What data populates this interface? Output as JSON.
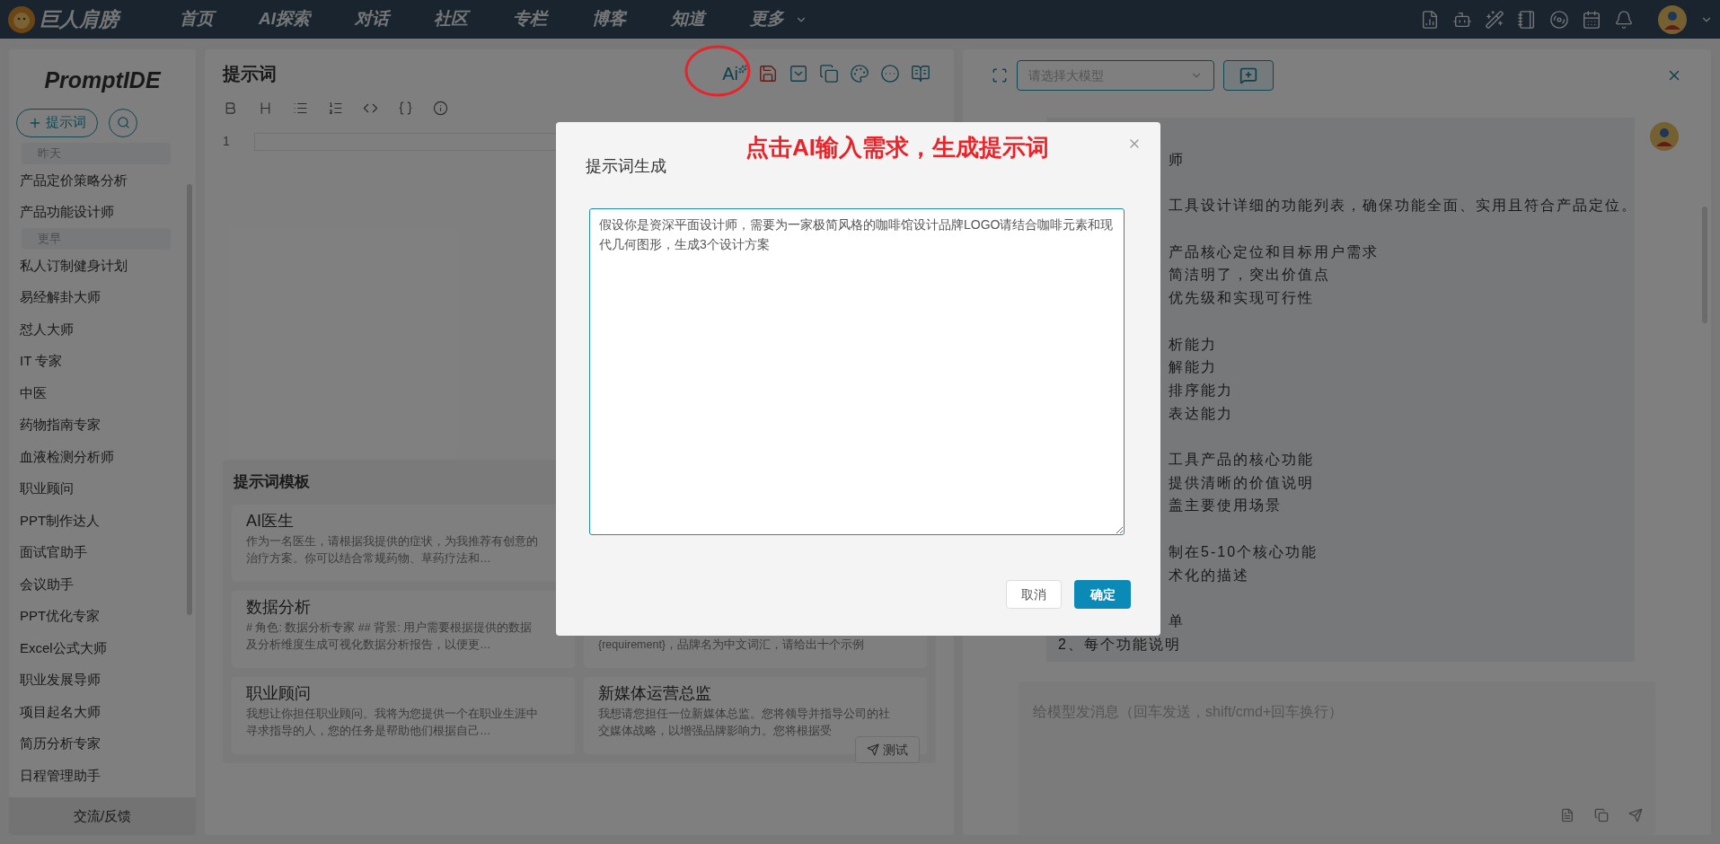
{
  "nav": {
    "logo": "巨人肩膀",
    "links": [
      "首页",
      "AI探索",
      "对话",
      "社区",
      "专栏",
      "博客",
      "知道"
    ],
    "more": "更多"
  },
  "sidebar": {
    "title": "PromptIDE",
    "new_button": "提示词",
    "groups": [
      {
        "label": "昨天",
        "items": [
          "产品定价策略分析",
          "产品功能设计师"
        ]
      },
      {
        "label": "更早",
        "items": [
          "私人订制健身计划",
          "易经解卦大师",
          "怼人大师",
          "IT 专家",
          "中医",
          "药物指南专家",
          "血液检测分析师",
          "职业顾问",
          "PPT制作达人",
          "面试官助手",
          "会议助手",
          "PPT优化专家",
          "Excel公式大师",
          "职业发展导师",
          "项目起名大师",
          "简历分析专家",
          "日程管理助手"
        ]
      }
    ],
    "feedback": "交流/反馈"
  },
  "editor": {
    "title": "提示词",
    "ai_button": "Ai",
    "line_numbers": [
      "1"
    ],
    "templates": {
      "title": "提示词模板",
      "rows": [
        {
          "left": {
            "title": "AI医生",
            "text": "作为一名医生，请根据我提供的症状，为我推荐有创意的治疗方案。你可以结合常规药物、草药疗法和…"
          }
        },
        {
          "left": {
            "title": "数据分析",
            "text": "# 角色: 数据分析专家 ## 背景: 用户需要根据提供的数据及分析维度生成可视化数据分析报告，以便更…"
          },
          "right": {
            "text": "{requirement}，品牌名为中文词汇，请给出十个示例"
          }
        },
        {
          "left": {
            "title": "职业顾问",
            "text": "我想让你担任职业顾问。我将为您提供一个在职业生涯中寻求指导的人，您的任务是帮助他们根据自己…"
          },
          "right": {
            "title": "新媒体运营总监",
            "text": "我想请您担任一位新媒体总监。您将领导并指导公司的社交媒体战略，以增强品牌影响力。您将根据受"
          }
        }
      ]
    },
    "test_button": "测试"
  },
  "chat": {
    "model_select": {
      "placeholder": "请选择大模型"
    },
    "paragraphs": [
      [
        {
          "text": "师",
          "kind": "clipped"
        }
      ],
      [
        {
          "text": "工具设计详细的功能列表，确保功能全面、实用且符合产品定位。",
          "kind": "clipped"
        }
      ],
      [
        {
          "text": "产品核心定位和目标用户需求",
          "kind": "clipped"
        },
        {
          "text": "简洁明了，突出价值点",
          "kind": "clipped"
        },
        {
          "text": "优先级和实现可行性",
          "kind": "clipped"
        }
      ],
      [
        {
          "text": "析能力",
          "kind": "clipped"
        },
        {
          "text": "解能力",
          "kind": "clipped"
        },
        {
          "text": "排序能力",
          "kind": "clipped"
        },
        {
          "text": "表达能力",
          "kind": "clipped"
        }
      ],
      [
        {
          "text": "工具产品的核心功能",
          "kind": "clipped"
        },
        {
          "text": "提供清晰的价值说明",
          "kind": "clipped"
        },
        {
          "text": "盖主要使用场景",
          "kind": "clipped"
        }
      ],
      [
        {
          "text": "制在5-10个核心功能",
          "kind": "clipped"
        },
        {
          "text": "术化的描述",
          "kind": "clipped"
        }
      ],
      [
        {
          "text": "单",
          "kind": "clipped"
        },
        {
          "text": "2、每个功能说明",
          "kind": "full"
        }
      ]
    ],
    "input": {
      "placeholder": "给模型发消息（回车发送，shift/cmd+回车换行）"
    }
  },
  "modal": {
    "title": "提示词生成",
    "annotation": "点击AI输入需求，生成提示词",
    "value": "假设你是资深平面设计师，需要为一家极简风格的咖啡馆设计品牌LOGO请结合咖啡元素和现代几何图形，生成3个设计方案",
    "cancel": "取消",
    "confirm": "确定"
  }
}
